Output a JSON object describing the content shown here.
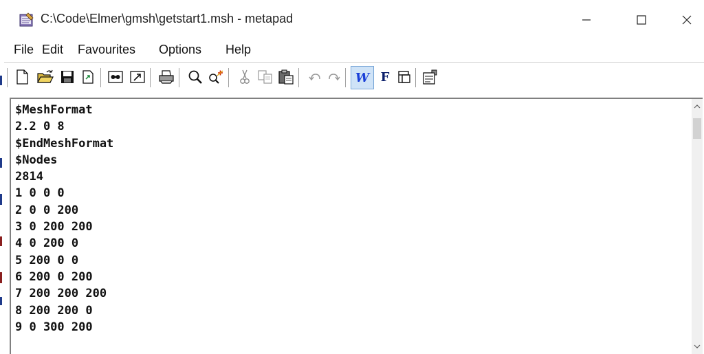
{
  "window": {
    "title": "C:\\Code\\Elmer\\gmsh\\getstart1.msh - metapad",
    "app_icon": "notepad-icon"
  },
  "menu": {
    "items": [
      "File",
      "Edit",
      "Favourites",
      "Options",
      "Help"
    ]
  },
  "toolbar": {
    "buttons": [
      "new-icon",
      "open-icon",
      "save-icon",
      "save-as-icon",
      "find-replace-icon",
      "goto-icon",
      "print-icon",
      "find-icon",
      "find-next-icon",
      "cut-icon",
      "copy-icon",
      "paste-icon",
      "undo-icon",
      "redo-icon",
      "word-wrap-icon",
      "font-icon",
      "transparent-icon",
      "settings-icon"
    ],
    "word_wrap_glyph": "W",
    "font_glyph": "F"
  },
  "editor": {
    "lines": [
      "$MeshFormat",
      "2.2 0 8",
      "$EndMeshFormat",
      "$Nodes",
      "2814",
      "1 0 0 0",
      "2 0 0 200",
      "3 0 200 200",
      "4 0 200 0",
      "5 200 0 0",
      "6 200 0 200",
      "7 200 200 200",
      "8 200 200 0",
      "9 0 300 200"
    ]
  },
  "colors": {
    "text": "#111111",
    "accent_blue": "#1f3a8a",
    "word_wrap_blue": "#1a3fd8",
    "font_navy": "#0b1f6b"
  }
}
